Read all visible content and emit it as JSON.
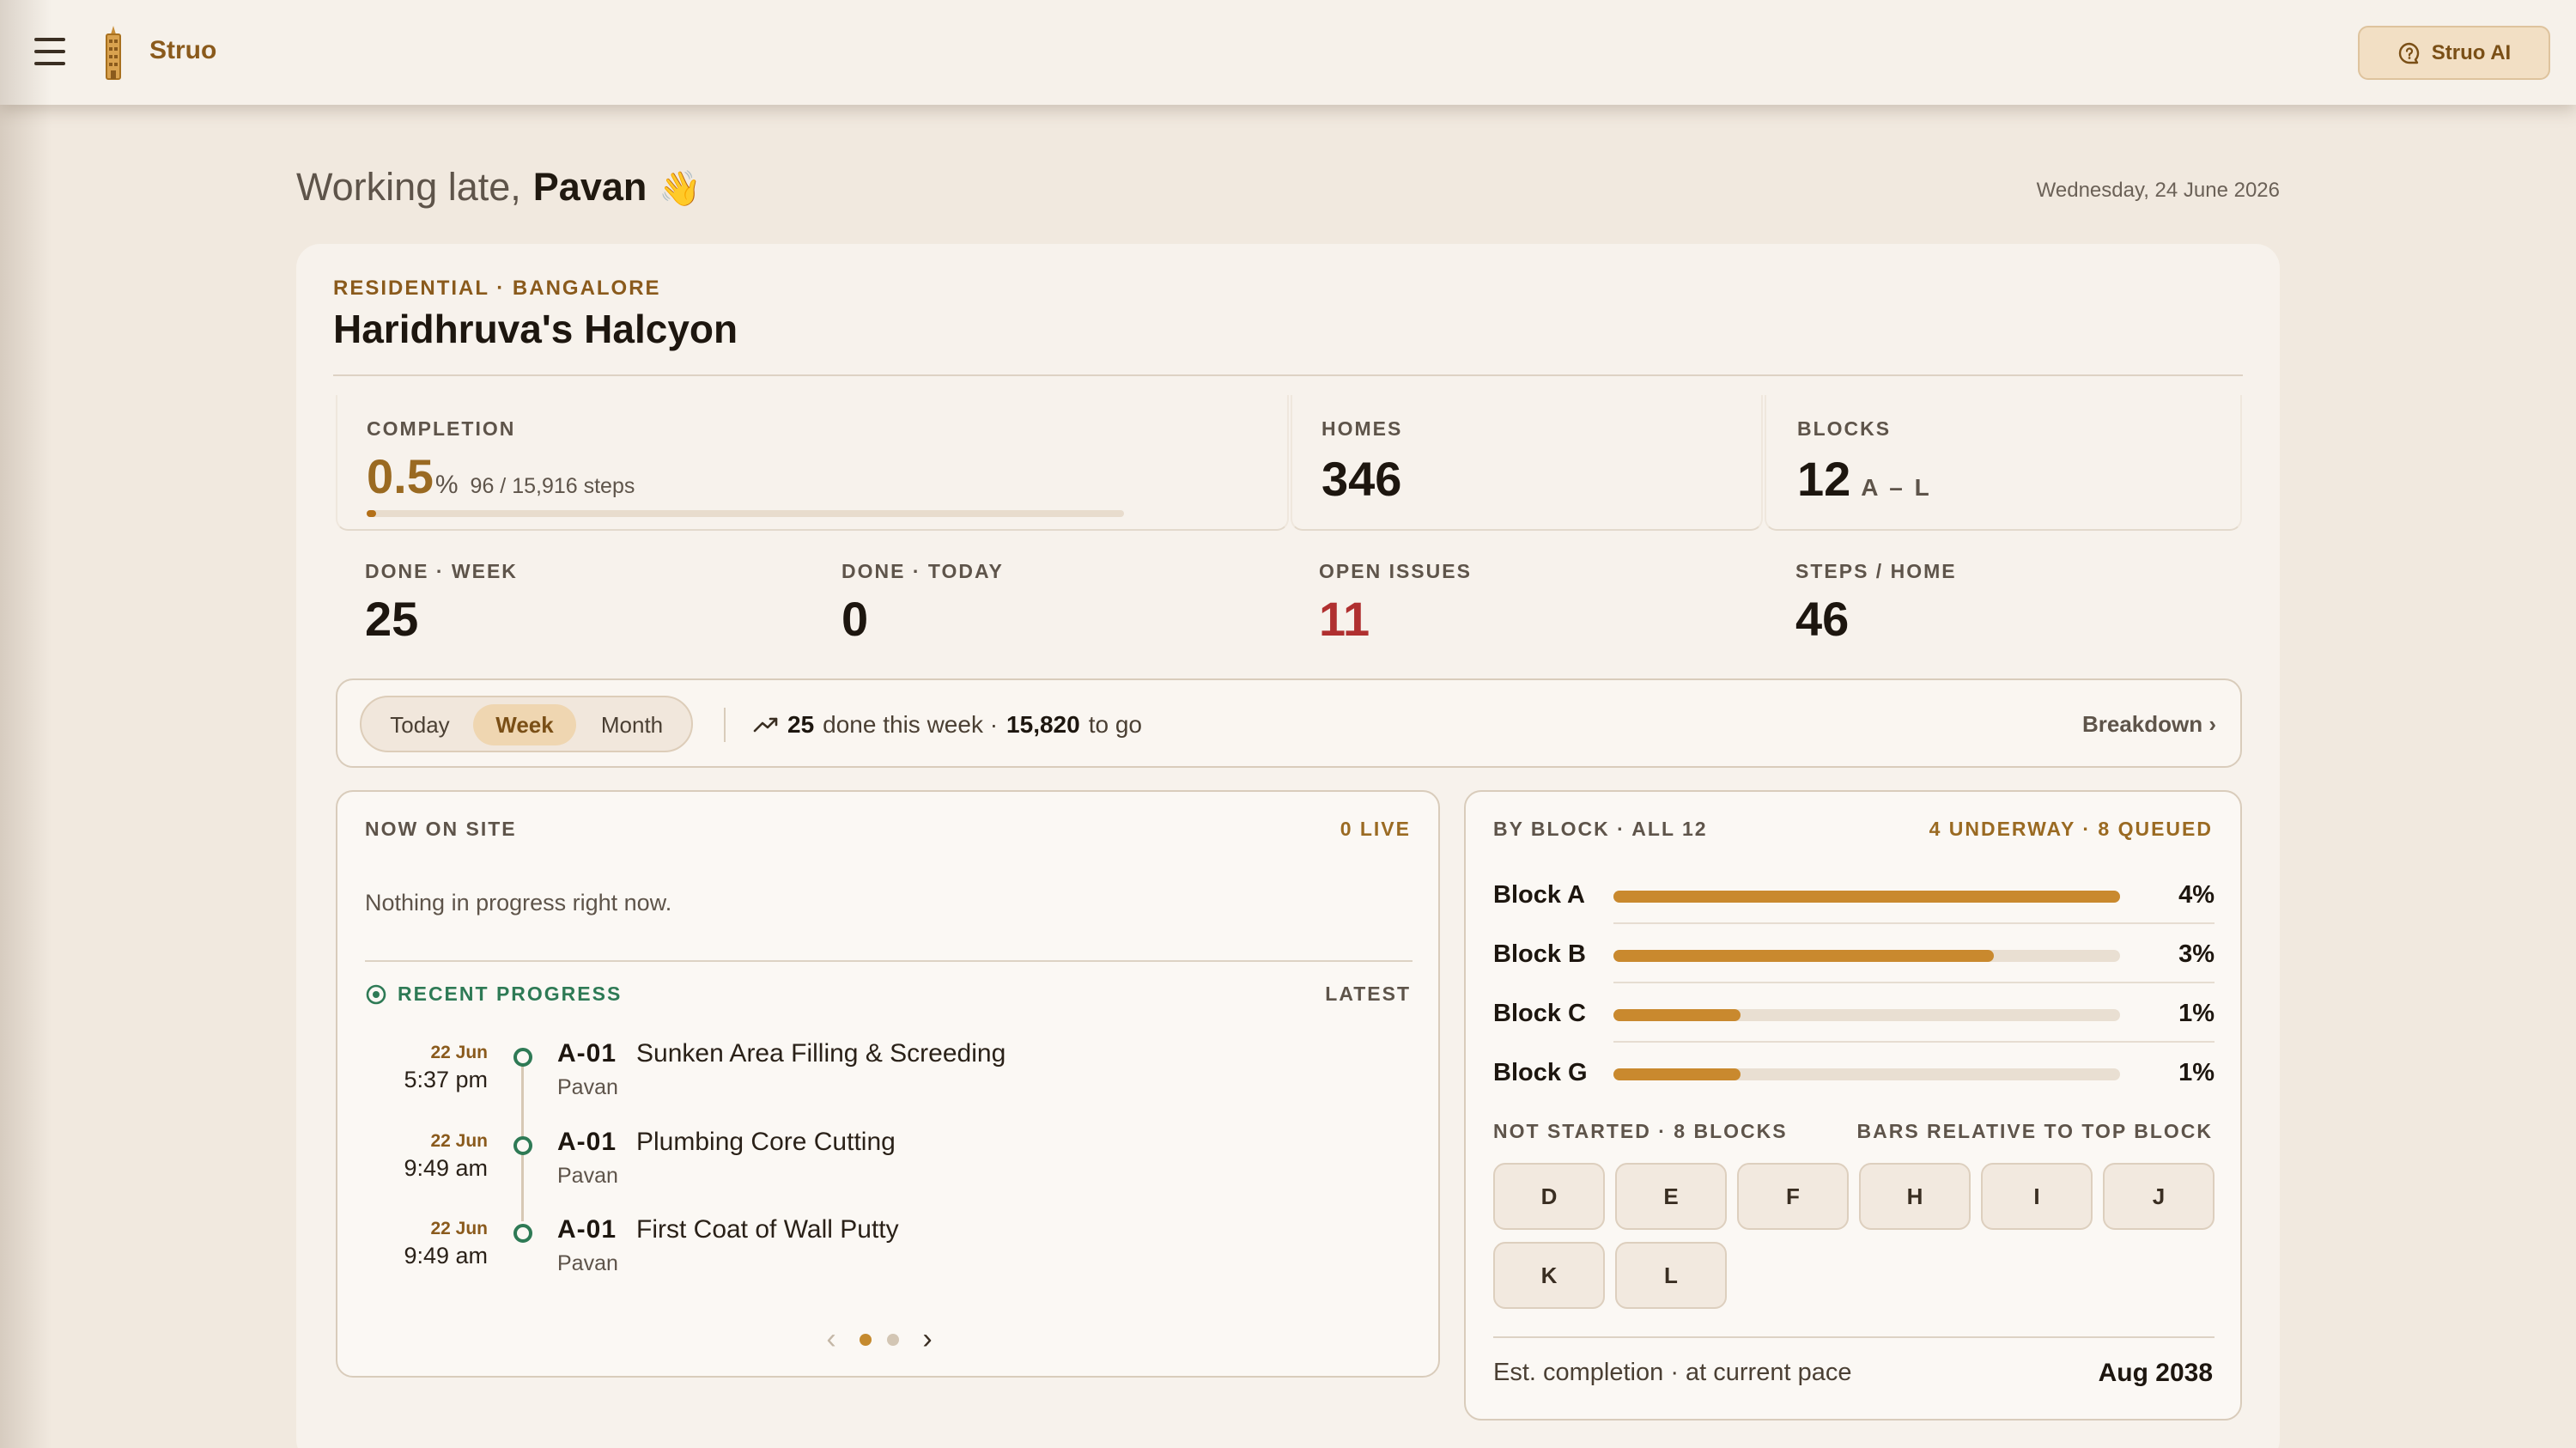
{
  "topbar": {
    "brand": "Struo",
    "ai_button": "Struo AI"
  },
  "greeting": {
    "prefix": "Working late,",
    "name": "Pavan",
    "emoji": "👋",
    "date": "Wednesday, 24 June 2026"
  },
  "project": {
    "category": "RESIDENTIAL · BANGALORE",
    "name": "Haridhruva's Halcyon"
  },
  "stats": {
    "completion_label": "COMPLETION",
    "completion_value": "0.5",
    "completion_unit": "%",
    "completion_steps": "96 / 15,916 steps",
    "completion_fraction": 0.005,
    "homes_label": "HOMES",
    "homes_value": "346",
    "blocks_label": "BLOCKS",
    "blocks_value": "12",
    "blocks_range": "A – L",
    "done_week_label": "DONE · WEEK",
    "done_week_value": "25",
    "done_today_label": "DONE · TODAY",
    "done_today_value": "0",
    "open_issues_label": "OPEN ISSUES",
    "open_issues_value": "11",
    "steps_home_label": "STEPS / HOME",
    "steps_home_value": "46"
  },
  "range": {
    "tabs": [
      "Today",
      "Week",
      "Month"
    ],
    "active": "Week",
    "done_count": "25",
    "done_text": "done this week ·",
    "to_go_count": "15,820",
    "to_go_text": "to go",
    "breakdown": "Breakdown ›"
  },
  "site": {
    "label": "NOW ON SITE",
    "live": "0 LIVE",
    "empty": "Nothing in progress right now.",
    "recent_label": "RECENT PROGRESS",
    "latest_label": "LATEST",
    "items": [
      {
        "date": "22 Jun",
        "time": "5:37 pm",
        "code": "A-01",
        "title": "Sunken Area Filling & Screeding",
        "user": "Pavan"
      },
      {
        "date": "22 Jun",
        "time": "9:49 am",
        "code": "A-01",
        "title": "Plumbing Core Cutting",
        "user": "Pavan"
      },
      {
        "date": "22 Jun",
        "time": "9:49 am",
        "code": "A-01",
        "title": "First Coat of Wall Putty",
        "user": "Pavan"
      }
    ],
    "prev": "‹",
    "next": "›"
  },
  "blocks": {
    "label": "BY BLOCK · ALL 12",
    "status": "4 UNDERWAY · 8 QUEUED",
    "rows": [
      {
        "name": "Block A",
        "pct": "4%",
        "relative": 1.0
      },
      {
        "name": "Block B",
        "pct": "3%",
        "relative": 0.75
      },
      {
        "name": "Block C",
        "pct": "1%",
        "relative": 0.25
      },
      {
        "name": "Block G",
        "pct": "1%",
        "relative": 0.25
      }
    ],
    "not_started_label": "NOT STARTED · 8 BLOCKS",
    "relative_note": "BARS RELATIVE TO TOP BLOCK",
    "not_started": [
      "D",
      "E",
      "F",
      "H",
      "I",
      "J",
      "K",
      "L"
    ],
    "est_label": "Est. completion · at current pace",
    "est_value": "Aug 2038"
  },
  "colors": {
    "accent": "#9a6a22",
    "bar": "#c9892e",
    "issues": "#b03030",
    "recent": "#2e7a55"
  }
}
